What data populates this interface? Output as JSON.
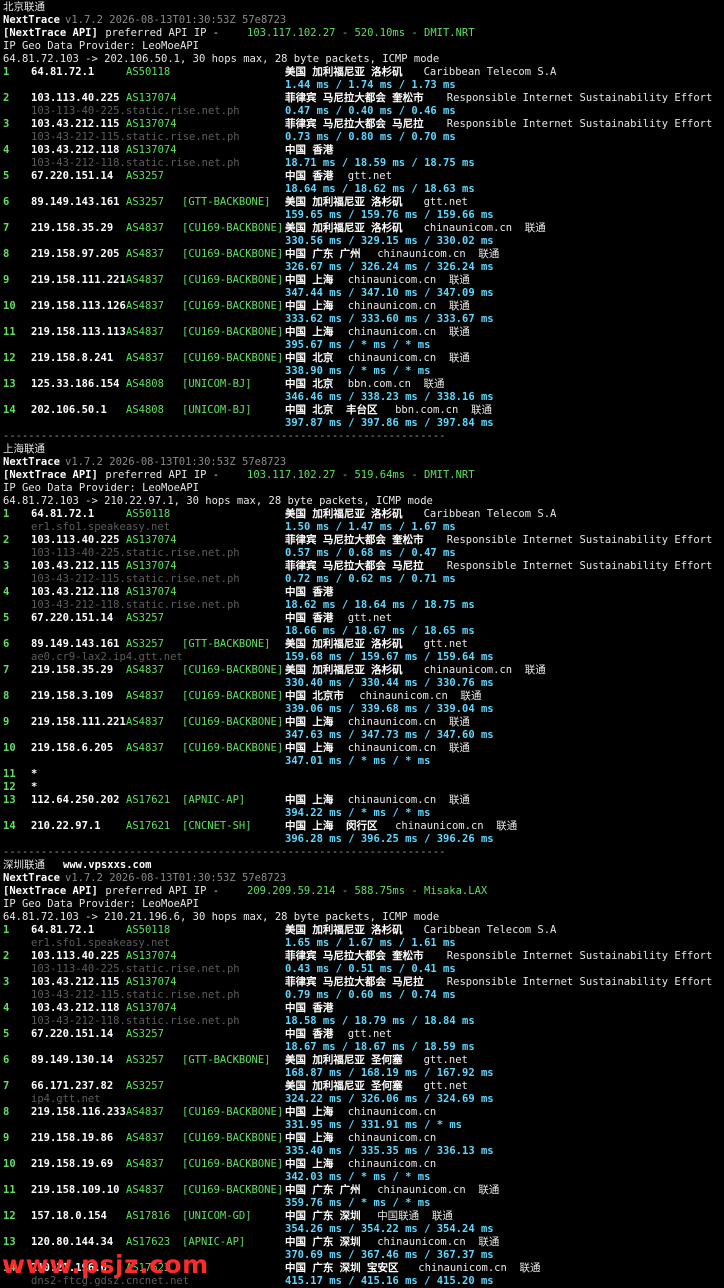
{
  "sections": [
    {
      "title": "北京联通",
      "extra": "",
      "version": "v1.7.2 2026-08-13T01:30:53Z 57e8723",
      "api_tag": "[NextTrace API]",
      "api_text": " preferred API IP - ",
      "api_ip": "103.117.102.27 - 520.10ms - DMIT.NRT",
      "geo": "IP Geo Data Provider: LeoMoeAPI",
      "header": "64.81.72.103 -> 202.106.50.1, 30 hops max, 28 byte packets, ICMP mode",
      "hops": [
        {
          "n": "1",
          "ip": "64.81.72.1",
          "as": "AS50118",
          "tag": "",
          "geo": "美国 加利福尼亚 洛杉矶",
          "org": "Caribbean Telecom S.A",
          "rdns": "",
          "rtt": "1.44 ms / 1.74 ms / 1.73 ms"
        },
        {
          "n": "2",
          "ip": "103.113.40.225",
          "as": "AS137074",
          "tag": "",
          "geo": "菲律宾 马尼拉大都会 奎松市",
          "org": "Responsible Internet Sustainability Effort",
          "rdns": "103-113-40-225.static.rise.net.ph",
          "rtt": "0.47 ms / 0.40 ms / 0.46 ms"
        },
        {
          "n": "3",
          "ip": "103.43.212.115",
          "as": "AS137074",
          "tag": "",
          "geo": "菲律宾 马尼拉大都会 马尼拉",
          "org": "Responsible Internet Sustainability Effort",
          "rdns": "103-43-212-115.static.rise.net.ph",
          "rtt": "0.73 ms / 0.80 ms / 0.70 ms"
        },
        {
          "n": "4",
          "ip": "103.43.212.118",
          "as": "AS137074",
          "tag": "",
          "geo": "中国 香港",
          "org": "",
          "rdns": "103-43-212-118.static.rise.net.ph",
          "rtt": "18.71 ms / 18.59 ms / 18.75 ms"
        },
        {
          "n": "5",
          "ip": "67.220.151.14",
          "as": "AS3257",
          "tag": "",
          "geo": "中国 香港",
          "org": "gtt.net",
          "rdns": "",
          "rtt": "18.64 ms / 18.62 ms / 18.63 ms"
        },
        {
          "n": "6",
          "ip": "89.149.143.161",
          "as": "AS3257",
          "tag": "[GTT-BACKBONE]",
          "geo": "美国 加利福尼亚 洛杉矶",
          "org": "gtt.net",
          "rdns": "",
          "rtt": "159.65 ms / 159.76 ms / 159.66 ms"
        },
        {
          "n": "7",
          "ip": "219.158.35.29",
          "as": "AS4837",
          "tag": "[CU169-BACKBONE]",
          "geo": "美国 加利福尼亚 洛杉矶",
          "org": "chinaunicom.cn  联通",
          "rdns": "",
          "rtt": "330.56 ms / 329.15 ms / 330.02 ms"
        },
        {
          "n": "8",
          "ip": "219.158.97.205",
          "as": "AS4837",
          "tag": "[CU169-BACKBONE]",
          "geo": "中国 广东 广州",
          "org": "chinaunicom.cn  联通",
          "rdns": "",
          "rtt": "326.67 ms / 326.24 ms / 326.24 ms"
        },
        {
          "n": "9",
          "ip": "219.158.111.221",
          "as": "AS4837",
          "tag": "[CU169-BACKBONE]",
          "geo": "中国 上海",
          "org": "chinaunicom.cn  联通",
          "rdns": "",
          "rtt": "347.44 ms / 347.10 ms / 347.09 ms"
        },
        {
          "n": "10",
          "ip": "219.158.113.126",
          "as": "AS4837",
          "tag": "[CU169-BACKBONE]",
          "geo": "中国 上海",
          "org": "chinaunicom.cn  联通",
          "rdns": "",
          "rtt": "333.62 ms / 333.60 ms / 333.67 ms"
        },
        {
          "n": "11",
          "ip": "219.158.113.113",
          "as": "AS4837",
          "tag": "[CU169-BACKBONE]",
          "geo": "中国 上海",
          "org": "chinaunicom.cn  联通",
          "rdns": "",
          "rtt": "395.67 ms / * ms / * ms"
        },
        {
          "n": "12",
          "ip": "219.158.8.241",
          "as": "AS4837",
          "tag": "[CU169-BACKBONE]",
          "geo": "中国 北京",
          "org": "chinaunicom.cn  联通",
          "rdns": "",
          "rtt": "338.90 ms / * ms / * ms"
        },
        {
          "n": "13",
          "ip": "125.33.186.154",
          "as": "AS4808",
          "tag": "[UNICOM-BJ]",
          "geo": "中国 北京",
          "org": "bbn.com.cn  联通",
          "rdns": "",
          "rtt": "346.46 ms / 338.23 ms / 338.16 ms"
        },
        {
          "n": "14",
          "ip": "202.106.50.1",
          "as": "AS4808",
          "tag": "[UNICOM-BJ]",
          "geo": "中国 北京  丰台区",
          "org": "bbn.com.cn  联通",
          "rdns": "",
          "rtt": "397.87 ms / 397.86 ms / 397.84 ms"
        }
      ],
      "divider": "----------------------------------------------------------------------"
    },
    {
      "title": "上海联通",
      "extra": "",
      "version": "v1.7.2 2026-08-13T01:30:53Z 57e8723",
      "api_tag": "[NextTrace API]",
      "api_text": " preferred API IP - ",
      "api_ip": "103.117.102.27 - 519.64ms - DMIT.NRT",
      "geo": "IP Geo Data Provider: LeoMoeAPI",
      "header": "64.81.72.103 -> 210.22.97.1, 30 hops max, 28 byte packets, ICMP mode",
      "hops": [
        {
          "n": "1",
          "ip": "64.81.72.1",
          "as": "AS50118",
          "tag": "",
          "geo": "美国 加利福尼亚 洛杉矶",
          "org": "Caribbean Telecom S.A",
          "rdns": "er1.sfo1.speakeasy.net",
          "rtt": "1.50 ms / 1.47 ms / 1.67 ms"
        },
        {
          "n": "2",
          "ip": "103.113.40.225",
          "as": "AS137074",
          "tag": "",
          "geo": "菲律宾 马尼拉大都会 奎松市",
          "org": "Responsible Internet Sustainability Effort",
          "rdns": "103-113-40-225.static.rise.net.ph",
          "rtt": "0.57 ms / 0.68 ms / 0.47 ms"
        },
        {
          "n": "3",
          "ip": "103.43.212.115",
          "as": "AS137074",
          "tag": "",
          "geo": "菲律宾 马尼拉大都会 马尼拉",
          "org": "Responsible Internet Sustainability Effort",
          "rdns": "103-43-212-115.static.rise.net.ph",
          "rtt": "0.72 ms / 0.62 ms / 0.71 ms"
        },
        {
          "n": "4",
          "ip": "103.43.212.118",
          "as": "AS137074",
          "tag": "",
          "geo": "中国 香港",
          "org": "",
          "rdns": "103-43-212-118.static.rise.net.ph",
          "rtt": "18.62 ms / 18.64 ms / 18.75 ms"
        },
        {
          "n": "5",
          "ip": "67.220.151.14",
          "as": "AS3257",
          "tag": "",
          "geo": "中国 香港",
          "org": "gtt.net",
          "rdns": "",
          "rtt": "18.66 ms / 18.67 ms / 18.65 ms"
        },
        {
          "n": "6",
          "ip": "89.149.143.161",
          "as": "AS3257",
          "tag": "[GTT-BACKBONE]",
          "geo": "美国 加利福尼亚 洛杉矶",
          "org": "gtt.net",
          "rdns": "ae0.cr9-lax2.ip4.gtt.net",
          "rtt": "159.68 ms / 159.67 ms / 159.64 ms"
        },
        {
          "n": "7",
          "ip": "219.158.35.29",
          "as": "AS4837",
          "tag": "[CU169-BACKBONE]",
          "geo": "美国 加利福尼亚 洛杉矶",
          "org": "chinaunicom.cn  联通",
          "rdns": "",
          "rtt": "330.40 ms / 330.44 ms / 330.76 ms"
        },
        {
          "n": "8",
          "ip": "219.158.3.109",
          "as": "AS4837",
          "tag": "[CU169-BACKBONE]",
          "geo": "中国 北京市",
          "org": "chinaunicom.cn  联通",
          "rdns": "",
          "rtt": "339.06 ms / 339.68 ms / 339.04 ms"
        },
        {
          "n": "9",
          "ip": "219.158.111.221",
          "as": "AS4837",
          "tag": "[CU169-BACKBONE]",
          "geo": "中国 上海",
          "org": "chinaunicom.cn  联通",
          "rdns": "",
          "rtt": "347.63 ms / 347.73 ms / 347.60 ms"
        },
        {
          "n": "10",
          "ip": "219.158.6.205",
          "as": "AS4837",
          "tag": "[CU169-BACKBONE]",
          "geo": "中国 上海",
          "org": "chinaunicom.cn  联通",
          "rdns": "",
          "rtt": "347.01 ms / * ms / * ms"
        },
        {
          "n": "11",
          "ip": "*",
          "as": "",
          "tag": "",
          "geo": "",
          "org": "",
          "rdns": "",
          "rtt": "",
          "blank": true
        },
        {
          "n": "12",
          "ip": "*",
          "as": "",
          "tag": "",
          "geo": "",
          "org": "",
          "rdns": "",
          "rtt": "",
          "blank": true
        },
        {
          "n": "13",
          "ip": "112.64.250.202",
          "as": "AS17621",
          "tag": "[APNIC-AP]",
          "geo": "中国 上海",
          "org": "chinaunicom.cn  联通",
          "rdns": "",
          "rtt": "394.22 ms / * ms / * ms"
        },
        {
          "n": "14",
          "ip": "210.22.97.1",
          "as": "AS17621",
          "tag": "[CNCNET-SH]",
          "geo": "中国 上海  闵行区",
          "org": "chinaunicom.cn  联通",
          "rdns": "",
          "rtt": "396.28 ms / 396.25 ms / 396.26 ms"
        }
      ],
      "divider": "----------------------------------------------------------------------"
    },
    {
      "title": "深圳联通",
      "extra": "www.vpsxxs.com",
      "version": "v1.7.2 2026-08-13T01:30:53Z 57e8723",
      "api_tag": "[NextTrace API]",
      "api_text": " preferred API IP - ",
      "api_ip": "209.209.59.214 - 588.75ms - Misaka.LAX",
      "geo": "IP Geo Data Provider: LeoMoeAPI",
      "header": "64.81.72.103 -> 210.21.196.6, 30 hops max, 28 byte packets, ICMP mode",
      "hops": [
        {
          "n": "1",
          "ip": "64.81.72.1",
          "as": "AS50118",
          "tag": "",
          "geo": "美国 加利福尼亚 洛杉矶",
          "org": "Caribbean Telecom S.A",
          "rdns": "er1.sfo1.speakeasy.net",
          "rtt": "1.65 ms / 1.67 ms / 1.61 ms"
        },
        {
          "n": "2",
          "ip": "103.113.40.225",
          "as": "AS137074",
          "tag": "",
          "geo": "菲律宾 马尼拉大都会 奎松市",
          "org": "Responsible Internet Sustainability Effort",
          "rdns": "103-113-40-225.static.rise.net.ph",
          "rtt": "0.43 ms / 0.51 ms / 0.41 ms"
        },
        {
          "n": "3",
          "ip": "103.43.212.115",
          "as": "AS137074",
          "tag": "",
          "geo": "菲律宾 马尼拉大都会 马尼拉",
          "org": "Responsible Internet Sustainability Effort",
          "rdns": "103-43-212-115.static.rise.net.ph",
          "rtt": "0.79 ms / 0.60 ms / 0.74 ms"
        },
        {
          "n": "4",
          "ip": "103.43.212.118",
          "as": "AS137074",
          "tag": "",
          "geo": "中国 香港",
          "org": "",
          "rdns": "103-43-212-118.static.rise.net.ph",
          "rtt": "18.58 ms / 18.79 ms / 18.84 ms"
        },
        {
          "n": "5",
          "ip": "67.220.151.14",
          "as": "AS3257",
          "tag": "",
          "geo": "中国 香港",
          "org": "gtt.net",
          "rdns": "",
          "rtt": "18.67 ms / 18.67 ms / 18.59 ms"
        },
        {
          "n": "6",
          "ip": "89.149.130.14",
          "as": "AS3257",
          "tag": "[GTT-BACKBONE]",
          "geo": "美国 加利福尼亚 圣何塞",
          "org": "gtt.net",
          "rdns": "",
          "rtt": "168.87 ms / 168.19 ms / 167.92 ms"
        },
        {
          "n": "7",
          "ip": "66.171.237.82",
          "as": "AS3257",
          "tag": "",
          "geo": "美国 加利福尼亚 圣何塞",
          "org": "gtt.net",
          "rdns": "ip4.gtt.net",
          "rtt": "324.22 ms / 326.06 ms / 324.69 ms"
        },
        {
          "n": "8",
          "ip": "219.158.116.233",
          "as": "AS4837",
          "tag": "[CU169-BACKBONE]",
          "geo": "中国 上海",
          "org": "chinaunicom.cn",
          "rdns": "",
          "rtt": "331.95 ms / 331.91 ms / * ms"
        },
        {
          "n": "9",
          "ip": "219.158.19.86",
          "as": "AS4837",
          "tag": "[CU169-BACKBONE]",
          "geo": "中国 上海",
          "org": "chinaunicom.cn",
          "rdns": "",
          "rtt": "335.40 ms / 335.35 ms / 336.13 ms"
        },
        {
          "n": "10",
          "ip": "219.158.19.69",
          "as": "AS4837",
          "tag": "[CU169-BACKBONE]",
          "geo": "中国 上海",
          "org": "chinaunicom.cn",
          "rdns": "",
          "rtt": "342.03 ms / * ms / * ms"
        },
        {
          "n": "11",
          "ip": "219.158.109.10",
          "as": "AS4837",
          "tag": "[CU169-BACKBONE]",
          "geo": "中国 广东 广州",
          "org": "chinaunicom.cn  联通",
          "rdns": "",
          "rtt": "359.76 ms / * ms / * ms"
        },
        {
          "n": "12",
          "ip": "157.18.0.154",
          "as": "AS17816",
          "tag": "[UNICOM-GD]",
          "geo": "中国 广东 深圳",
          "org": "中国联通  联通",
          "rdns": "",
          "rtt": "354.26 ms / 354.22 ms / 354.24 ms"
        },
        {
          "n": "13",
          "ip": "120.80.144.34",
          "as": "AS17623",
          "tag": "[APNIC-AP]",
          "geo": "中国 广东 深圳",
          "org": "chinaunicom.cn  联通",
          "rdns": "",
          "rtt": "370.69 ms / 367.46 ms / 367.37 ms"
        },
        {
          "n": "14",
          "ip": "210.21.196.6",
          "as": "AS17623",
          "tag": "",
          "geo": "中国 广东 深圳 宝安区",
          "org": "chinaunicom.cn  联通",
          "rdns": "dns2-ftcg.gdsz.cncnet.net",
          "rtt": "415.17 ms / 415.16 ms / 415.20 ms"
        }
      ],
      "divider": ""
    }
  ],
  "watermark": "www.psjz.com",
  "colors": {
    "background": "#000000",
    "text": "#e6e6e6",
    "as_hop": "#5fe05f",
    "rtt": "#5fd7ff",
    "rdns": "#5d5d5d",
    "version": "#8a8a8a",
    "api_ip": "#e8e85a",
    "watermark": "#ff2a2a"
  }
}
